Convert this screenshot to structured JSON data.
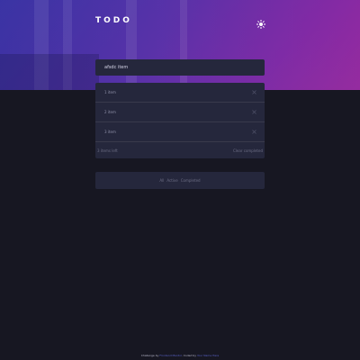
{
  "app": {
    "title": "TODO",
    "theme_toggle_icon": "sun-icon"
  },
  "new_todo": {
    "placeholder": "afsdc item",
    "value": ""
  },
  "todos": [
    {
      "label": "1 item"
    },
    {
      "label": "2 item"
    },
    {
      "label": "3 item"
    }
  ],
  "list_footer": {
    "items_left": "3 items left",
    "clear_completed": "Clear completed"
  },
  "filters": {
    "all": "All",
    "active": "Active",
    "completed": "Completed"
  },
  "attribution": {
    "challenge_prefix": "Challenge by",
    "challenge_link": "Frontend Mentor",
    "coded_prefix": ". Coded by",
    "coded_link": "Your Name Here"
  },
  "colors": {
    "background": "#171722",
    "card": "#25273c",
    "gradient_start": "#3b35a8",
    "gradient_end": "#a0309e"
  }
}
